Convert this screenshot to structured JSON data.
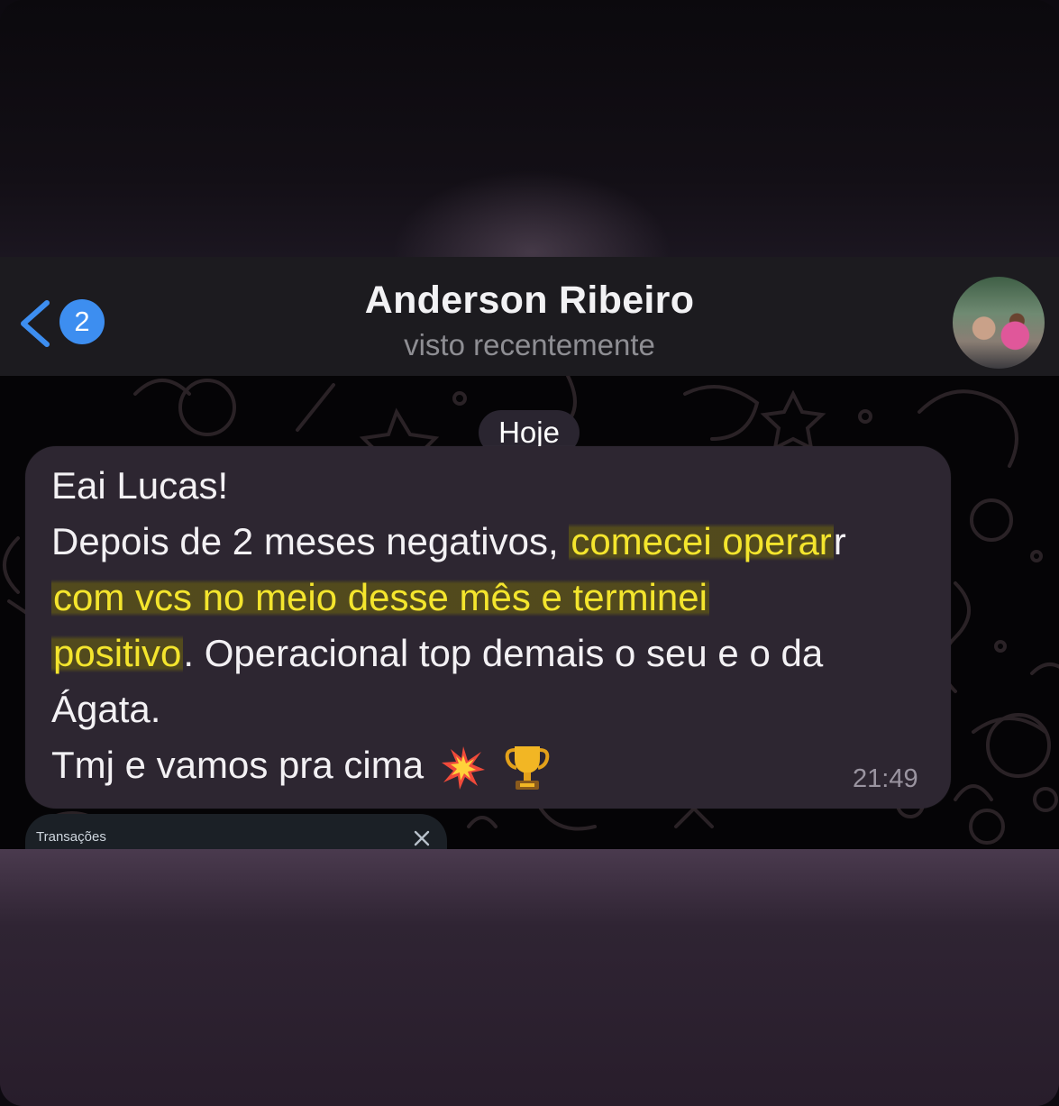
{
  "header": {
    "back_badge_count": "2",
    "contact_name": "Anderson Ribeiro",
    "contact_status": "visto recentemente"
  },
  "chat": {
    "date_label": "Hoje",
    "message": {
      "line1": "Eai Lucas!",
      "line2_plain": "Depois de 2 meses negativos, ",
      "line2_highlight": "comecei operar",
      "line2_tail": "r",
      "line3_highlight": "com vcs no meio desse mês e terminei",
      "line4_highlight": "positivo",
      "line4_plain": ". Operacional top demais o seu e o da",
      "line5": "Ágata.",
      "line6": "Tmj e vamos pra cima",
      "time": "21:49"
    }
  },
  "mini_panel": {
    "title": "Transações"
  },
  "colors": {
    "accent_blue": "#3d8ef0",
    "highlight_yellow": "#f4e52d",
    "bubble_bg": "#2d2631",
    "header_bg": "#1c1b1f"
  },
  "icons": [
    "chevron-left-icon",
    "collision-emoji-icon",
    "trophy-emoji-icon",
    "close-icon"
  ]
}
